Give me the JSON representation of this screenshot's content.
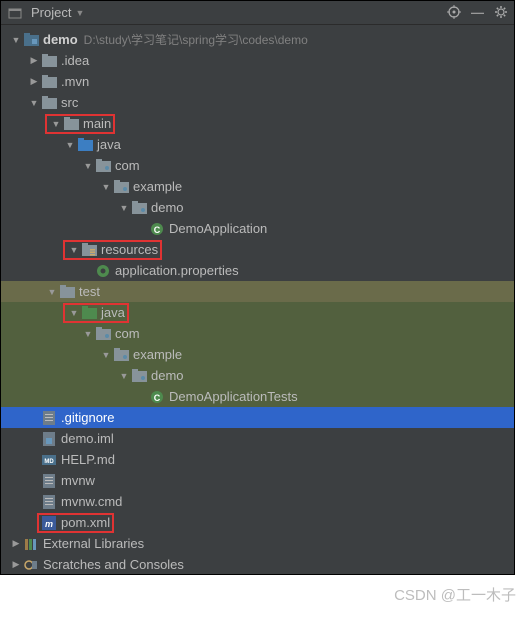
{
  "header": {
    "title": "Project",
    "collapse_label": "—"
  },
  "project": {
    "name": "demo",
    "path": "D:\\study\\学习笔记\\spring学习\\codes\\demo"
  },
  "tree": {
    "idea": ".idea",
    "mvn": ".mvn",
    "src": "src",
    "main": "main",
    "java_main": "java",
    "com_main": "com",
    "example_main": "example",
    "demo_main": "demo",
    "demo_app": "DemoApplication",
    "resources": "resources",
    "app_props": "application.properties",
    "test": "test",
    "java_test": "java",
    "com_test": "com",
    "example_test": "example",
    "demo_test": "demo",
    "demo_tests": "DemoApplicationTests",
    "gitignore": ".gitignore",
    "demo_iml": "demo.iml",
    "help_md": "HELP.md",
    "mvnw": "mvnw",
    "mvnw_cmd": "mvnw.cmd",
    "pom_xml": "pom.xml",
    "ext_libs": "External Libraries",
    "scratches": "Scratches and Consoles"
  },
  "watermark": "CSDN @工一木子"
}
